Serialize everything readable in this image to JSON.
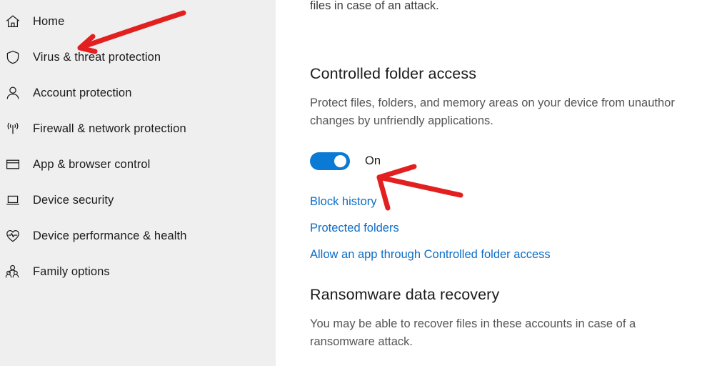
{
  "sidebar": {
    "items": [
      {
        "label": "Home",
        "icon": "home-icon"
      },
      {
        "label": "Virus & threat protection",
        "icon": "shield-icon"
      },
      {
        "label": "Account protection",
        "icon": "person-icon"
      },
      {
        "label": "Firewall & network protection",
        "icon": "wireless-signal-icon"
      },
      {
        "label": "App & browser control",
        "icon": "window-icon"
      },
      {
        "label": "Device security",
        "icon": "laptop-icon"
      },
      {
        "label": "Device performance & health",
        "icon": "heart-pulse-icon"
      },
      {
        "label": "Family options",
        "icon": "people-icon"
      }
    ]
  },
  "main": {
    "intro_tail": "files in case of an attack.",
    "controlled_folder_access": {
      "heading": "Controlled folder access",
      "description_line1": "Protect files, folders, and memory areas on your device from unauthor",
      "description_line2": "changes by unfriendly applications.",
      "toggle_state": "On",
      "links": [
        "Block history",
        "Protected folders",
        "Allow an app through Controlled folder access"
      ]
    },
    "ransomware_data_recovery": {
      "heading": "Ransomware data recovery",
      "description_line1": "You may be able to recover files in these accounts in case of a",
      "description_line2": "ransomware attack."
    }
  },
  "annotations": {
    "color": "#e32020",
    "arrow_1_target": "Virus & threat protection",
    "arrow_2_target": "Controlled folder access toggle"
  },
  "colors": {
    "sidebar_background": "#efefef",
    "content_background": "#ffffff",
    "toggle_on": "#0a7ad4",
    "link": "#0c6dc7",
    "heading_text": "#1b1b1b",
    "body_text": "#555555",
    "annotation_red": "#e32020"
  }
}
